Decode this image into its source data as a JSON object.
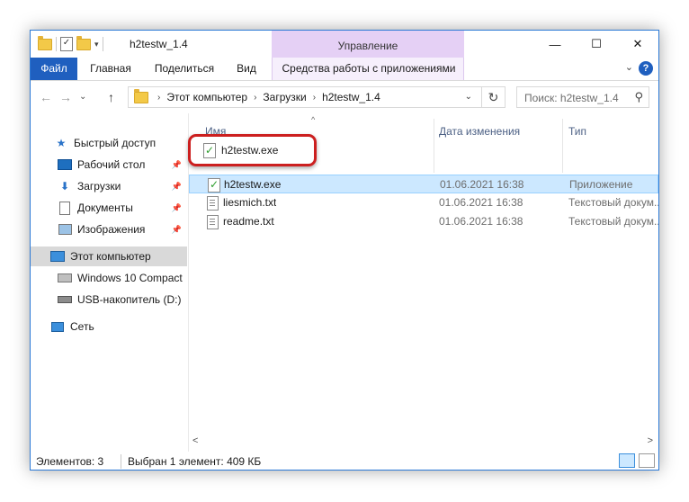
{
  "window": {
    "title": "h2testw_1.4",
    "contextual_tab_group": "Управление",
    "controls": {
      "minimize": "—",
      "maximize": "☐",
      "close": "✕"
    }
  },
  "ribbon": {
    "tabs": [
      "Файл",
      "Главная",
      "Поделиться",
      "Вид",
      "Средства работы с приложениями"
    ],
    "help": "?",
    "collapse": "⌄"
  },
  "address_bar": {
    "crumbs": [
      "Этот компьютер",
      "Загрузки",
      "h2testw_1.4"
    ],
    "search_placeholder": "Поиск: h2testw_1.4"
  },
  "navigation": {
    "back": "←",
    "forward": "→",
    "recent": "⌄",
    "up": "↑",
    "refresh": "↻"
  },
  "nav_pane": {
    "quick_access": "Быстрый доступ",
    "quick_items": [
      "Рабочий стол",
      "Загрузки",
      "Документы",
      "Изображения"
    ],
    "this_pc": "Этот компьютер",
    "drives": [
      "Windows 10 Compact",
      "USB-накопитель (D:)"
    ],
    "network": "Сеть"
  },
  "columns": {
    "name": "Имя",
    "date": "Дата изменения",
    "type": "Тип"
  },
  "files": [
    {
      "name": "h2testw.exe",
      "date": "01.06.2021 16:38",
      "type": "Приложение",
      "icon": "exe-icon",
      "selected": true
    },
    {
      "name": "liesmich.txt",
      "date": "01.06.2021 16:38",
      "type": "Текстовый докум...",
      "icon": "text-file-icon",
      "selected": false
    },
    {
      "name": "readme.txt",
      "date": "01.06.2021 16:38",
      "type": "Текстовый докум...",
      "icon": "text-file-icon",
      "selected": false
    }
  ],
  "highlight": {
    "label": "h2testw.exe",
    "color": "#cc1f1f"
  },
  "status": {
    "items": "Элементов: 3",
    "selection": "Выбран 1 элемент: 409 КБ"
  },
  "colors": {
    "accent": "#1f5fbf",
    "manage_band": "#e5d0f5",
    "selection": "#cce8ff"
  }
}
